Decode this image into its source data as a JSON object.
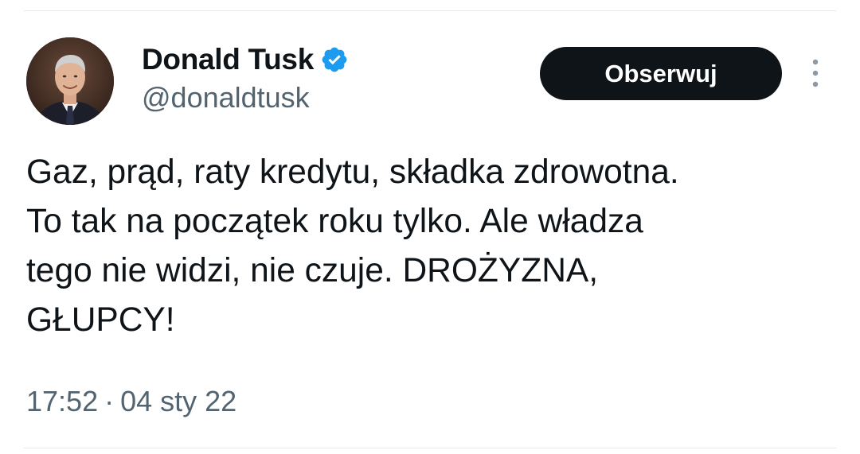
{
  "author": {
    "display_name": "Donald Tusk",
    "handle": "@donaldtusk",
    "verified": true,
    "verified_icon": "verified-badge-icon",
    "avatar_icon": "avatar-photo"
  },
  "actions": {
    "follow_label": "Obserwuj",
    "more_icon": "more-vertical-icon"
  },
  "tweet": {
    "text": "Gaz, prąd, raty kredytu, składka zdrowotna.\nTo tak na początek roku tylko. Ale władza\ntego nie widzi, nie czuje. DROŻYZNA,\nGŁUPCY!"
  },
  "meta": {
    "time": "17:52",
    "separator": "·",
    "date": "04 sty 22"
  },
  "colors": {
    "text_primary": "#0f1419",
    "text_secondary": "#536471",
    "verified_blue": "#1d9bf0",
    "button_bg": "#0f1419",
    "button_text": "#ffffff",
    "divider": "#e6e9ec"
  }
}
